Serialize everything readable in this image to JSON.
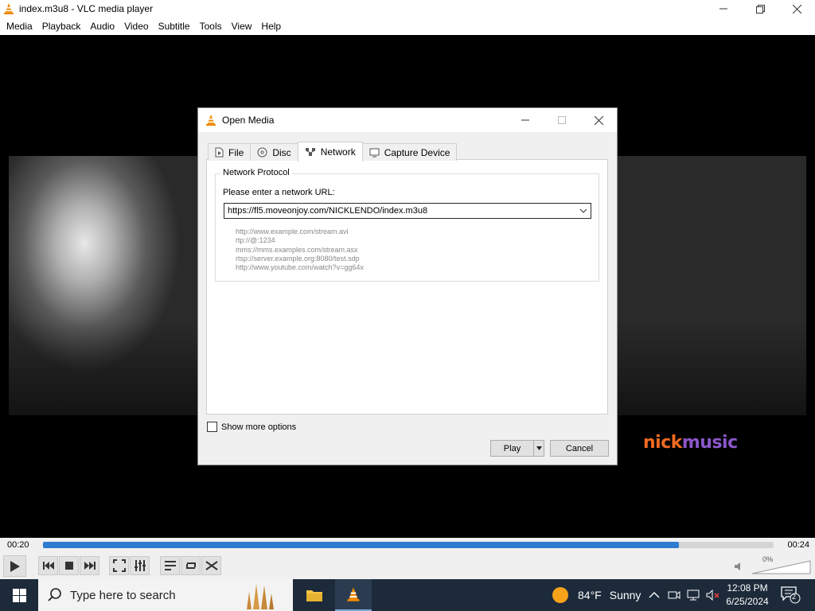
{
  "window": {
    "title": "index.m3u8 - VLC media player"
  },
  "menubar": [
    "Media",
    "Playback",
    "Audio",
    "Video",
    "Subtitle",
    "Tools",
    "View",
    "Help"
  ],
  "video": {
    "logo_part1": "nick",
    "logo_part2": "music"
  },
  "player": {
    "elapsed": "00:20",
    "remaining": "00:24",
    "progress_fraction": 0.87,
    "volume": "0%"
  },
  "dialog": {
    "title": "Open Media",
    "tabs": [
      {
        "label": "File",
        "icon": "file-icon"
      },
      {
        "label": "Disc",
        "icon": "disc-icon"
      },
      {
        "label": "Network",
        "icon": "network-icon",
        "active": true
      },
      {
        "label": "Capture Device",
        "icon": "capture-device-icon"
      }
    ],
    "group_label": "Network Protocol",
    "prompt": "Please enter a network URL:",
    "url_value": "https://fl5.moveonjoy.com/NICKLENDO/index.m3u8",
    "examples": [
      "http://www.example.com/stream.avi",
      "rtp://@:1234",
      "mms://mms.examples.com/stream.asx",
      "rtsp://server.example.org:8080/test.sdp",
      "http://www.youtube.com/watch?v=gg64x"
    ],
    "show_more_options": "Show more options",
    "play_label": "Play",
    "cancel_label": "Cancel"
  },
  "taskbar": {
    "search_placeholder": "Type here to search",
    "weather_temp": "84°F",
    "weather_cond": "Sunny",
    "time": "12:08 PM",
    "date": "6/25/2024",
    "notification_count": "2"
  },
  "colors": {
    "accent": "#2f7bd1",
    "taskbar": "#1c2a3a",
    "vlc_orange": "#f08a00"
  }
}
